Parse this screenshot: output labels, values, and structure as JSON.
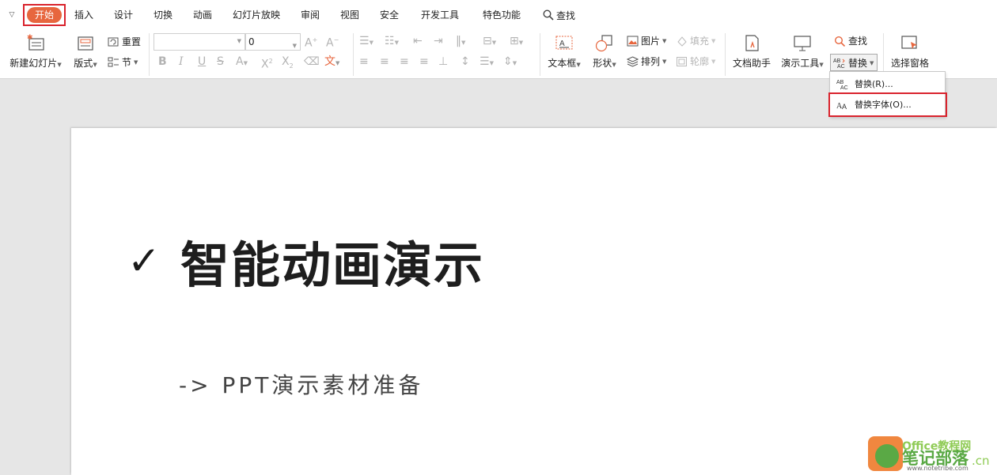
{
  "tabs": {
    "home": "开始",
    "insert": "插入",
    "design": "设计",
    "transition": "切换",
    "animation": "动画",
    "slideshow": "幻灯片放映",
    "review": "审阅",
    "view": "视图",
    "security": "安全",
    "developer": "开发工具",
    "special": "特色功能",
    "find": "查找"
  },
  "ribbon": {
    "new_slide": "新建幻灯片",
    "layout": "版式",
    "reset": "重置",
    "section": "节",
    "font_name": "",
    "font_size": "0",
    "text_box": "文本框",
    "shape": "形状",
    "picture": "图片",
    "fill": "填充",
    "arrange": "排列",
    "outline": "轮廓",
    "doc_assistant": "文档助手",
    "present_tools": "演示工具",
    "find": "查找",
    "replace": "替换",
    "selection_pane": "选择窗格"
  },
  "dropdown": {
    "replace": "替换(R)...",
    "replace_font": "替换字体(O)..."
  },
  "slide": {
    "title": "智能动画演示",
    "subtitle": "-> PPT演示素材准备"
  },
  "watermark": {
    "office": "Office教程网",
    "brand": "笔记部落",
    "url": "www.notetribe.com",
    "cn": ".cn"
  },
  "colors": {
    "accent": "#e7663e",
    "highlight": "#d9232d"
  }
}
